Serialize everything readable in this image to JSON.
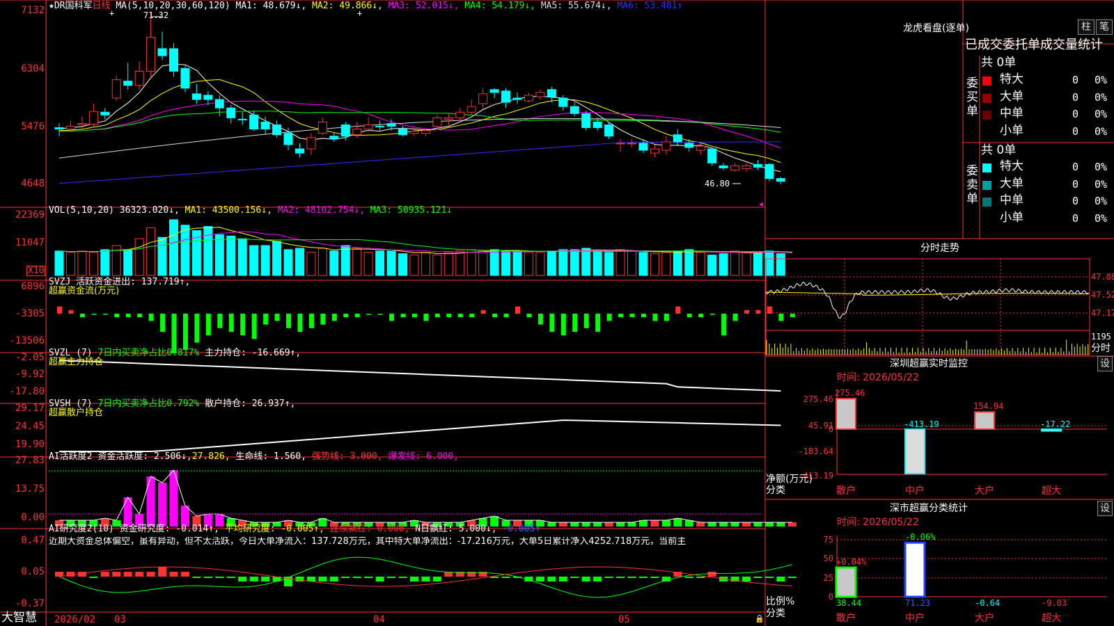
{
  "main": {
    "title": "★DR国科军",
    "period": "日线",
    "ma_params": "MA(5,10,20,30,60,120)",
    "ma_items": [
      {
        "t": "MA1: 48.679↓,",
        "c": "#ffffff"
      },
      {
        "t": "MA2: 49.866↓,",
        "c": "#ffff00"
      },
      {
        "t": "MA3: 52.015↓,",
        "c": "#ff00ff"
      },
      {
        "t": "MA4: 54.179↓,",
        "c": "#00ff00"
      },
      {
        "t": "MA5: 55.674↓,",
        "c": "#dcdcdc"
      },
      {
        "t": "MA6: 53.481↑",
        "c": "#3030ff"
      }
    ],
    "y_ticks": [
      "7132",
      "6304",
      "5476",
      "4648"
    ],
    "high_label": "71.32",
    "low_label": "46.80"
  },
  "candles": [
    {
      "o": 54.8,
      "c": 54.6,
      "h": 55.4,
      "l": 53.6
    },
    {
      "o": 54.6,
      "c": 55.0,
      "h": 55.8,
      "l": 54.2
    },
    {
      "o": 55.2,
      "c": 55.4,
      "h": 56.4,
      "l": 54.6
    },
    {
      "o": 55.3,
      "c": 57.1,
      "h": 58.2,
      "l": 55.0
    },
    {
      "o": 57.0,
      "c": 56.6,
      "h": 57.6,
      "l": 56.0
    },
    {
      "o": 59.0,
      "c": 61.6,
      "h": 62.2,
      "l": 58.6
    },
    {
      "o": 61.4,
      "c": 60.8,
      "h": 64.0,
      "l": 60.2
    },
    {
      "o": 60.8,
      "c": 62.8,
      "h": 64.2,
      "l": 60.2
    },
    {
      "o": 62.8,
      "c": 67.6,
      "h": 71.3,
      "l": 62.0
    },
    {
      "o": 66.0,
      "c": 65.0,
      "h": 68.4,
      "l": 64.4
    },
    {
      "o": 66.0,
      "c": 62.8,
      "h": 66.8,
      "l": 62.0
    },
    {
      "o": 63.2,
      "c": 60.4,
      "h": 63.6,
      "l": 59.8
    },
    {
      "o": 59.6,
      "c": 58.8,
      "h": 61.0,
      "l": 58.2
    },
    {
      "o": 59.4,
      "c": 58.8,
      "h": 60.0,
      "l": 58.0
    },
    {
      "o": 58.8,
      "c": 57.6,
      "h": 59.4,
      "l": 56.4
    },
    {
      "o": 57.6,
      "c": 56.2,
      "h": 58.0,
      "l": 55.4
    },
    {
      "o": 56.0,
      "c": 55.9,
      "h": 57.0,
      "l": 55.2
    },
    {
      "o": 56.6,
      "c": 54.6,
      "h": 57.2,
      "l": 54.4
    },
    {
      "o": 55.6,
      "c": 54.6,
      "h": 56.4,
      "l": 53.8
    },
    {
      "o": 55.2,
      "c": 53.8,
      "h": 55.8,
      "l": 53.4
    },
    {
      "o": 54.0,
      "c": 52.4,
      "h": 54.8,
      "l": 51.6
    },
    {
      "o": 51.8,
      "c": 51.2,
      "h": 52.6,
      "l": 50.6
    },
    {
      "o": 51.8,
      "c": 53.4,
      "h": 54.0,
      "l": 51.0
    },
    {
      "o": 54.0,
      "c": 55.6,
      "h": 56.2,
      "l": 53.8
    },
    {
      "o": 53.6,
      "c": 53.2,
      "h": 54.2,
      "l": 52.8
    },
    {
      "o": 55.2,
      "c": 53.6,
      "h": 55.6,
      "l": 53.0
    },
    {
      "o": 53.8,
      "c": 54.6,
      "h": 55.6,
      "l": 53.4
    },
    {
      "o": 54.6,
      "c": 55.2,
      "h": 56.2,
      "l": 54.2
    },
    {
      "o": 55.0,
      "c": 54.9,
      "h": 55.8,
      "l": 54.4
    },
    {
      "o": 55.4,
      "c": 55.0,
      "h": 56.0,
      "l": 54.4
    },
    {
      "o": 54.6,
      "c": 53.8,
      "h": 55.0,
      "l": 53.6
    },
    {
      "o": 54.0,
      "c": 54.3,
      "h": 54.6,
      "l": 53.6
    },
    {
      "o": 54.0,
      "c": 54.4,
      "h": 54.8,
      "l": 53.6
    },
    {
      "o": 55.0,
      "c": 56.2,
      "h": 56.6,
      "l": 54.8
    },
    {
      "o": 56.0,
      "c": 56.2,
      "h": 56.8,
      "l": 55.0
    },
    {
      "o": 56.2,
      "c": 57.0,
      "h": 57.6,
      "l": 55.8
    },
    {
      "o": 57.0,
      "c": 57.8,
      "h": 58.8,
      "l": 56.6
    },
    {
      "o": 58.2,
      "c": 59.6,
      "h": 60.4,
      "l": 57.4
    },
    {
      "o": 60.2,
      "c": 59.8,
      "h": 60.4,
      "l": 59.0
    },
    {
      "o": 60.0,
      "c": 58.4,
      "h": 60.4,
      "l": 57.6
    },
    {
      "o": 59.0,
      "c": 58.8,
      "h": 59.8,
      "l": 58.2
    },
    {
      "o": 58.6,
      "c": 59.4,
      "h": 59.8,
      "l": 58.4
    },
    {
      "o": 59.2,
      "c": 59.8,
      "h": 60.2,
      "l": 58.8
    },
    {
      "o": 60.2,
      "c": 59.2,
      "h": 60.6,
      "l": 58.4
    },
    {
      "o": 59.0,
      "c": 57.8,
      "h": 59.4,
      "l": 57.2
    },
    {
      "o": 57.8,
      "c": 56.8,
      "h": 58.4,
      "l": 56.4
    },
    {
      "o": 56.8,
      "c": 54.8,
      "h": 57.2,
      "l": 54.4
    },
    {
      "o": 55.6,
      "c": 54.8,
      "h": 56.2,
      "l": 54.4
    },
    {
      "o": 55.2,
      "c": 53.6,
      "h": 55.6,
      "l": 53.2
    },
    {
      "o": 52.6,
      "c": 52.6,
      "h": 53.2,
      "l": 51.4
    },
    {
      "o": 52.6,
      "c": 52.6,
      "h": 53.2,
      "l": 52.0
    },
    {
      "o": 52.6,
      "c": 51.6,
      "h": 53.2,
      "l": 51.2
    },
    {
      "o": 51.2,
      "c": 51.8,
      "h": 52.4,
      "l": 50.6
    },
    {
      "o": 51.6,
      "c": 52.8,
      "h": 53.6,
      "l": 51.0
    },
    {
      "o": 53.8,
      "c": 52.8,
      "h": 54.6,
      "l": 52.2
    },
    {
      "o": 52.6,
      "c": 52.0,
      "h": 53.2,
      "l": 51.4
    },
    {
      "o": 51.6,
      "c": 52.2,
      "h": 52.6,
      "l": 51.0
    },
    {
      "o": 51.8,
      "c": 49.8,
      "h": 52.0,
      "l": 49.4
    },
    {
      "o": 49.4,
      "c": 49.1,
      "h": 49.8,
      "l": 48.8
    },
    {
      "o": 48.8,
      "c": 49.4,
      "h": 49.8,
      "l": 48.6
    },
    {
      "o": 49.0,
      "c": 49.4,
      "h": 49.8,
      "l": 48.6
    },
    {
      "o": 49.6,
      "c": 49.2,
      "h": 50.2,
      "l": 48.8
    },
    {
      "o": 49.6,
      "c": 47.6,
      "h": 49.8,
      "l": 47.2
    },
    {
      "o": 47.6,
      "c": 47.2,
      "h": 47.8,
      "l": 46.8
    }
  ],
  "vol": {
    "title": "VOL(5,10,20)",
    "value": "36323.020↓,",
    "ma_items": [
      {
        "t": "MA1: 43500.156↓,",
        "c": "#ffff00"
      },
      {
        "t": "MA2: 48102.754↓,",
        "c": "#ff00ff"
      },
      {
        "t": "MA3: 50935.121↓",
        "c": "#00ff00"
      }
    ],
    "y_ticks": [
      "22369",
      "11047"
    ],
    "unit": "X10"
  },
  "svzj": {
    "title": "SVZJ",
    "line1": "活跃资金进出: 137.719↑,",
    "line2": "超赢资金流(万元)",
    "y_ticks": [
      "6896",
      "-3305",
      "-13506"
    ]
  },
  "svzl": {
    "title": "SVZL (7)",
    "a": "7日内买卖净占比0.817%",
    "b": "主力持仓: -16.669↑,",
    "line2": "超赢主力持仓",
    "y_ticks": [
      "-2.05",
      "-9.92",
      "-17.80"
    ]
  },
  "svsh": {
    "title": "SVSH (7)",
    "a": "7日内买卖净占比0.792%",
    "b": "散户持仓: 26.937↑,",
    "line2": "超赢散户持仓",
    "y_ticks": [
      "29.17",
      "24.45",
      "19.90"
    ]
  },
  "ai1": {
    "title": "AI活跃度2",
    "a": "资金活跃度: 2.506↓,",
    "b": "27.826,",
    "c": "生命线: 1.560,",
    "d": "强势线: 3.000,",
    "e": "爆发线: 6.000,",
    "y_ticks": [
      "27.83",
      "13.75",
      "0.00"
    ]
  },
  "ai2": {
    "title": "AI研究度2(10)",
    "a": "资金研究度: -0.014↑,",
    "b": "平均研究度: -0.005↑,",
    "c": "连续飘红: 0.000,",
    "d": "N日飘红: 5.000↓,",
    "e": "-0.005↑",
    "text": "近期大资金总体偏空，虽有异动，但不太活跃，今日大单净流入：137.728万元，其中特大单净流出：-17.216万元，大单5日累计净入4252.718万元，当前主",
    "y_ticks": [
      "0.47",
      "0.05",
      "-0.37"
    ]
  },
  "xaxis": {
    "labels": [
      "2026/02",
      "03",
      "04",
      "05"
    ],
    "brand": "大智慧"
  },
  "right": {
    "lhb_title": "龙虎看盘(逐单)",
    "btn_zhu": "柱",
    "btn_bi": "笔",
    "stats_title": "已成交委托单成交量统计",
    "buy_label": "委买单",
    "sell_label": "委卖单",
    "buy_total": "共 0单",
    "sell_total": "共 0单",
    "buy_rows": [
      {
        "name": "特大",
        "v": "0",
        "p": "0%",
        "c": "#ff0000"
      },
      {
        "name": "大单",
        "v": "0",
        "p": "0%",
        "c": "#9b0000"
      },
      {
        "name": "中单",
        "v": "0",
        "p": "0%",
        "c": "#6a0000"
      },
      {
        "name": "小单",
        "v": "0",
        "p": "0%",
        "c": ""
      }
    ],
    "sell_rows": [
      {
        "name": "特大",
        "v": "0",
        "p": "0%",
        "c": "#00ffff"
      },
      {
        "name": "大单",
        "v": "0",
        "p": "0%",
        "c": "#00a0a0"
      },
      {
        "name": "中单",
        "v": "0",
        "p": "0%",
        "c": "#007878"
      },
      {
        "name": "小单",
        "v": "0",
        "p": "0%",
        "c": ""
      }
    ],
    "fenshi_title": "分时走势",
    "fenshi_ticks": [
      "47.88",
      "47.52",
      "47.17",
      "1195",
      "分时"
    ],
    "monitor_title": "深圳超赢实时监控",
    "monitor_btn": "设",
    "monitor_time": "时间: 2026/05/22",
    "monitor_ticks": [
      "275.46",
      "45.91",
      "0",
      "-183.64",
      "-413.19"
    ],
    "monitor_bars": [
      {
        "cat": "散户",
        "v": 275.46,
        "label": "275.46"
      },
      {
        "cat": "中户",
        "v": -413.19,
        "label": "-413.19"
      },
      {
        "cat": "大户",
        "v": 154.94,
        "label": "154.94"
      },
      {
        "cat": "超大",
        "v": -17.22,
        "label": "-17.22"
      }
    ],
    "monitor_axis1": "净额(万元)",
    "monitor_axis2": "分类",
    "class_title": "深市超赢分类统计",
    "class_btn": "设",
    "class_time": "时间: 2026/05/22",
    "class_ticks": [
      "75",
      "50",
      "25",
      "0"
    ],
    "class_bars": [
      {
        "cat": "散户",
        "pct": 38.44,
        "label": "38.44",
        "top": "+0.04%"
      },
      {
        "cat": "中户",
        "pct": 71.23,
        "label": "71.23",
        "top": "-0.06%"
      },
      {
        "cat": "大户",
        "pct": -0.64,
        "label": "-0.64",
        "top": ""
      },
      {
        "cat": "超大",
        "pct": -9.03,
        "label": "-9.03",
        "top": ""
      }
    ],
    "class_axis1": "比例%",
    "class_axis2": "分类"
  }
}
